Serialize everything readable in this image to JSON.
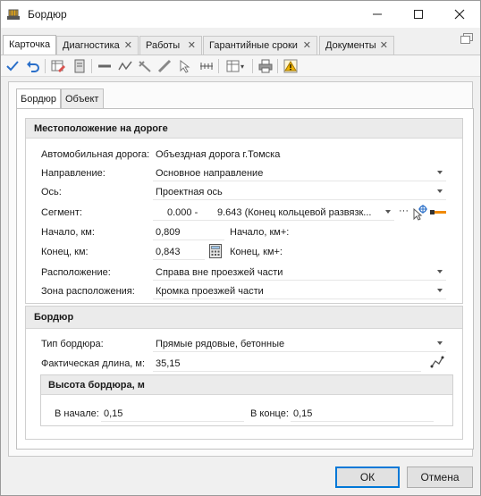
{
  "window": {
    "title": "Бордюр",
    "minimize_icon": "minimize-icon",
    "maximize_icon": "maximize-icon",
    "close_icon": "close-icon"
  },
  "tabs": [
    {
      "label": "Карточка",
      "active": true,
      "closable": false
    },
    {
      "label": "Диагностика",
      "active": false,
      "closable": true
    },
    {
      "label": "Работы",
      "active": false,
      "closable": true
    },
    {
      "label": "Гарантийные сроки",
      "active": false,
      "closable": true
    },
    {
      "label": "Документы",
      "active": false,
      "closable": true
    }
  ],
  "inner_tabs": [
    {
      "label": "Бордюр",
      "active": true
    },
    {
      "label": "Объект",
      "active": false
    }
  ],
  "location": {
    "header": "Местоположение на дороге",
    "road_label": "Автомобильная дорога:",
    "road_value": "Объездная дорога г.Томска",
    "direction_label": "Направление:",
    "direction_value": "Основное направление",
    "axis_label": "Ось:",
    "axis_value": "Проектная ось",
    "segment_label": "Сегмент:",
    "segment_start": "0.000 -",
    "segment_value": "9.643 (Конец кольцевой развязк...",
    "segment_more": "···",
    "start_km_label": "Начало, км:",
    "start_km_value": "0,809",
    "start_kmplus_label": "Начало, км+:",
    "end_km_label": "Конец, км:",
    "end_km_value": "0,843",
    "end_kmplus_label": "Конец, км+:",
    "placement_label": "Расположение:",
    "placement_value": "Справа вне проезжей части",
    "zone_label": "Зона расположения:",
    "zone_value": "Кромка проезжей части"
  },
  "curb": {
    "header": "Бордюр",
    "type_label": "Тип бордюра:",
    "type_value": "Прямые рядовые, бетонные",
    "length_label": "Фактическая длина, м:",
    "length_value": "35,15"
  },
  "height": {
    "header": "Высота бордюра, м",
    "start_label": "В начале:",
    "start_value": "0,15",
    "end_label": "В конце:",
    "end_value": "0,15"
  },
  "buttons": {
    "ok": "ОК",
    "cancel": "Отмена"
  },
  "colors": {
    "accent": "#0078d7",
    "group_header": "#ebebeb"
  }
}
